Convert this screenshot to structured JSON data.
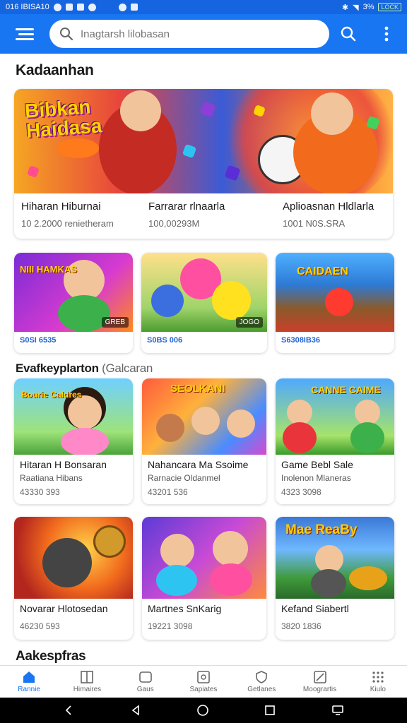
{
  "status": {
    "left_text": "016 IBISA10",
    "right_text": "3%",
    "battery": "LOCK"
  },
  "appbar": {
    "search_placeholder": "Inagtarsh lilobasan"
  },
  "section1": {
    "title": "Kadaanhan"
  },
  "hero": {
    "logo": [
      "Bibkan",
      "Haidasa"
    ],
    "items": [
      {
        "title": "Hiharan Hiburnai",
        "sub": "10 2.2000 renietheram"
      },
      {
        "title": "Farrarar rlnaarla",
        "sub": "100,00293M"
      },
      {
        "title": "Aplioasnan Hldlarla",
        "sub": "1001 N0S.SRA"
      }
    ]
  },
  "row1": [
    {
      "logo": "NIII HAMKAS",
      "chip": "GREB",
      "tag": "S0SI 6535"
    },
    {
      "logo": "",
      "chip": "JOGO",
      "tag": "S0BS 006"
    },
    {
      "logo": "CAIDAEN",
      "chip": "",
      "tag": "S6308IB36"
    }
  ],
  "section2": {
    "title": "Evafkeyplarton",
    "sub": "(Galcaran"
  },
  "grid": [
    {
      "logo": "Bourie Caldres",
      "title": "Hitaran H Bonsaran",
      "sub": "Raatiana Hibans",
      "num": "43330 393"
    },
    {
      "logo": "SEOLKANI",
      "title": "Nahancara Ma Ssoime",
      "sub": "Rarnacie Oldanmel",
      "num": "43201 536"
    },
    {
      "logo": "CANNE CAIME",
      "title": "Game Bebl Sale",
      "sub": "Inolenon Mlaneras",
      "num": "4323 3098"
    },
    {
      "logo": "",
      "title": "Novarar Hlotosedan",
      "sub": "",
      "num": "46230 593"
    },
    {
      "logo": "",
      "title": "Martnes SnKarig",
      "sub": "",
      "num": "19221 3098"
    },
    {
      "logo": "Mae ReaBy",
      "title": "Kefand Siabertl",
      "sub": "",
      "num": "3820 1836"
    }
  ],
  "section3": {
    "title": "Aakespfras"
  },
  "nav": [
    {
      "icon": "home-icon",
      "label": "Rannie"
    },
    {
      "icon": "book-icon",
      "label": "Himaires"
    },
    {
      "icon": "gamepad-icon",
      "label": "Gaus"
    },
    {
      "icon": "gallery-icon",
      "label": "Sapiates"
    },
    {
      "icon": "shield-icon",
      "label": "Getlanes"
    },
    {
      "icon": "tools-icon",
      "label": "Moogrartis"
    },
    {
      "icon": "grid-icon",
      "label": "Kiulo"
    }
  ],
  "colors": {
    "primary": "#1976f2",
    "tag_blue": "#1d62d6"
  }
}
